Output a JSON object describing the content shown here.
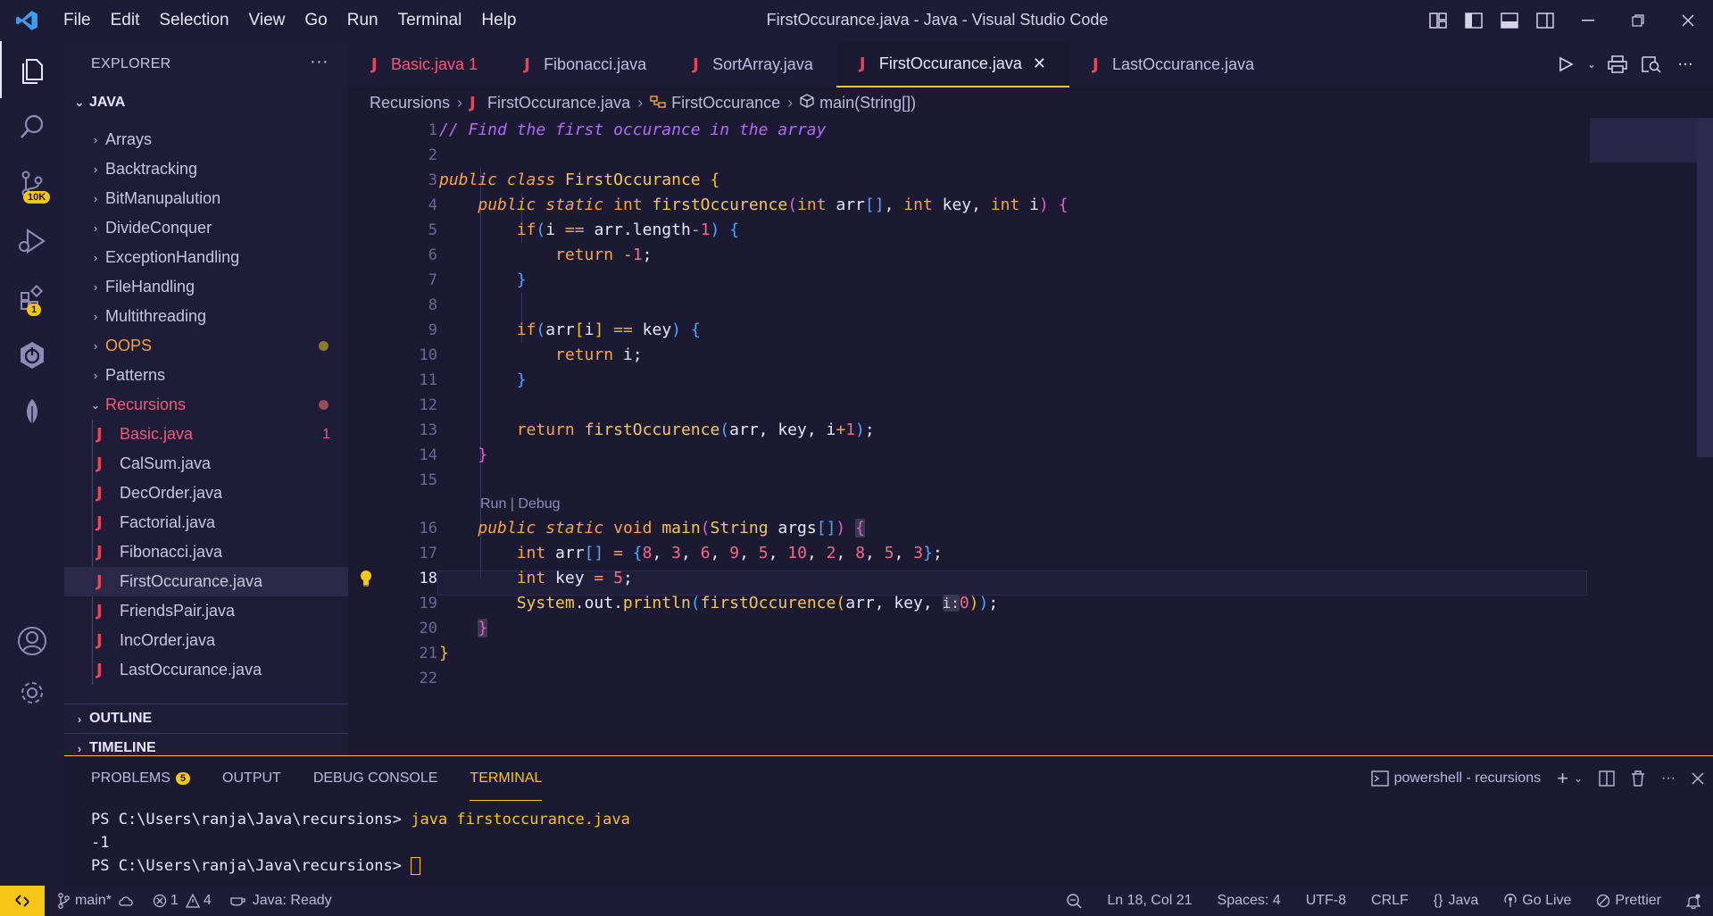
{
  "menu": [
    "File",
    "Edit",
    "Selection",
    "View",
    "Go",
    "Run",
    "Terminal",
    "Help"
  ],
  "window_title": "FirstOccurance.java - Java - Visual Studio Code",
  "activity_badges": {
    "source_control": "10K",
    "extensions": "1"
  },
  "sidebar": {
    "header": "EXPLORER",
    "section": "JAVA",
    "folders_top": [
      "Arrays",
      "Backtracking",
      "BitManupalution",
      "DivideConquer",
      "ExceptionHandling",
      "FileHandling",
      "Multithreading",
      "OOPS",
      "Patterns",
      "Recursions"
    ],
    "files": [
      "Basic.java",
      "CalSum.java",
      "DecOrder.java",
      "Factorial.java",
      "Fibonacci.java",
      "FirstOccurance.java",
      "FriendsPair.java",
      "IncOrder.java",
      "LastOccurance.java"
    ],
    "basic_error_count": "1",
    "outline": "OUTLINE",
    "timeline": "TIMELINE"
  },
  "tabs": [
    {
      "label": "Basic.java 1"
    },
    {
      "label": "Fibonacci.java"
    },
    {
      "label": "SortArray.java"
    },
    {
      "label": "FirstOccurance.java"
    },
    {
      "label": "LastOccurance.java"
    }
  ],
  "breadcrumbs": [
    "Recursions",
    "FirstOccurance.java",
    "FirstOccurance",
    "main(String[])"
  ],
  "codelens": "Run | Debug",
  "line_numbers": [
    "1",
    "2",
    "3",
    "4",
    "5",
    "6",
    "7",
    "8",
    "9",
    "10",
    "11",
    "12",
    "13",
    "14",
    "15",
    "16",
    "17",
    "18",
    "19",
    "20",
    "21",
    "22"
  ],
  "panel": {
    "tabs": [
      "PROBLEMS",
      "OUTPUT",
      "DEBUG CONSOLE",
      "TERMINAL"
    ],
    "problems_count": "5",
    "terminal_name": "powershell - recursions",
    "terminal_lines": [
      {
        "prompt": "PS C:\\Users\\ranja\\Java\\recursions> ",
        "cmd": "java firstoccurance.java"
      },
      {
        "prompt": "-1",
        "cmd": ""
      },
      {
        "prompt": "PS C:\\Users\\ranja\\Java\\recursions> ",
        "cmd": ""
      }
    ]
  },
  "status": {
    "branch": "main*",
    "errors": "1",
    "warnings": "4",
    "java_status": "Java: Ready",
    "position": "Ln 18, Col 21",
    "spaces": "Spaces: 4",
    "encoding": "UTF-8",
    "eol": "CRLF",
    "language": "Java",
    "golive": "Go Live",
    "prettier": "Prettier"
  },
  "colors": {
    "accent": "#f5c518",
    "error": "#ee5a7a",
    "folder_modified": "#f2a14b"
  }
}
